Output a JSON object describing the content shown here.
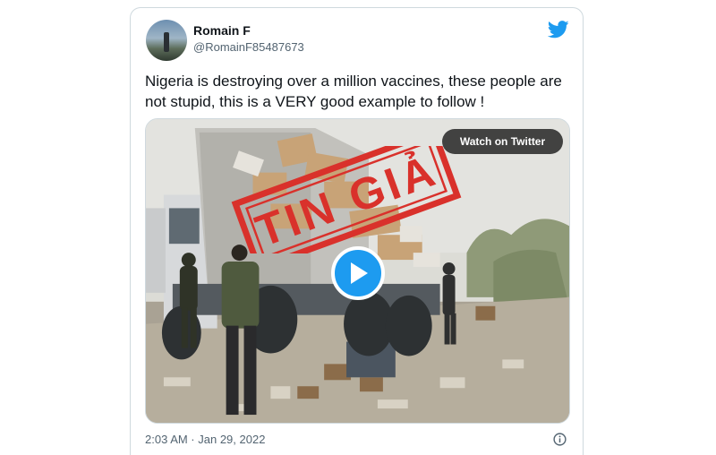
{
  "tweet": {
    "author_name": "Romain F",
    "author_handle": "@RomainF85487673",
    "text": "Nigeria is destroying over a million vaccines, these people are not stupid, this is a VERY good example to follow !",
    "timestamp": "2:03 AM · Jan 29, 2022"
  },
  "media": {
    "watch_label": "Watch on Twitter",
    "stamp_text": "TIN GIẢ",
    "stamp_color": "#d9312b"
  },
  "icons": {
    "brand": "twitter-bird-icon",
    "play": "play-icon",
    "info": "info-icon"
  },
  "colors": {
    "accent": "#1d9bf0",
    "text": "#0f1419",
    "muted": "#536471"
  }
}
